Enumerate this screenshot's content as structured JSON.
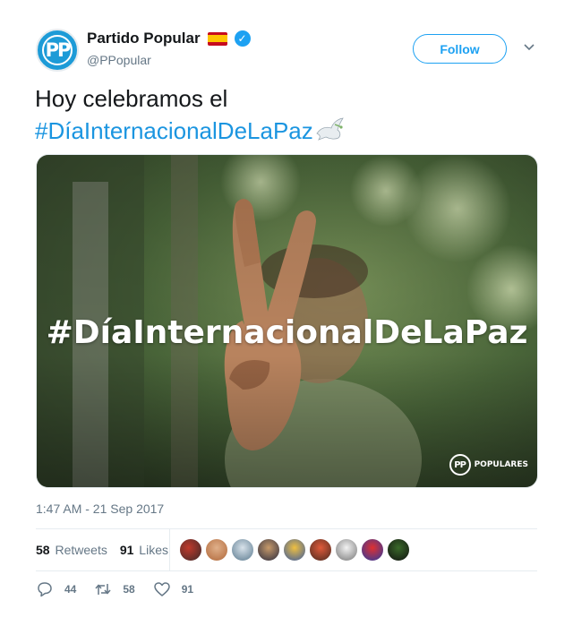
{
  "author": {
    "display_name": "Partido Popular",
    "handle": "@PPopular",
    "avatar_text": "PP",
    "verified_icon": "verified-badge-icon",
    "flag_icon": "spain-flag-icon"
  },
  "header": {
    "follow_label": "Follow",
    "more_icon": "chevron-down-icon"
  },
  "tweet": {
    "text_plain": "Hoy celebramos el",
    "hashtag": "#DíaInternacionalDeLaPaz",
    "emoji_icon": "dove-icon"
  },
  "media": {
    "overlay_hashtag": "#DíaInternacionalDeLaPaz",
    "logo_mark": "PP",
    "logo_text": "POPULARES"
  },
  "timestamp": "1:47 AM - 21 Sep 2017",
  "stats": {
    "retweets_count": "58",
    "retweets_label": "Retweets",
    "likes_count": "91",
    "likes_label": "Likes",
    "liker_avatars": 9
  },
  "actions": {
    "reply_count": "44",
    "retweet_count": "58",
    "like_count": "91"
  },
  "colors": {
    "accent": "#1da1f2",
    "hashtag": "#1b95e0",
    "muted": "#657786",
    "avatar_bg": "#1d9bd7"
  }
}
